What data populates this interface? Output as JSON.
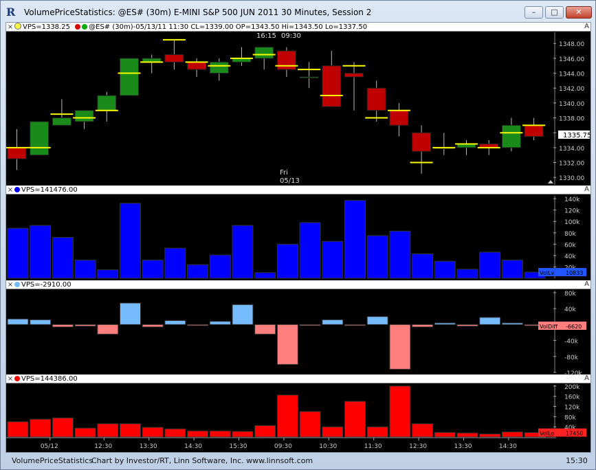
{
  "window": {
    "title": "VolumePriceStatistics: @ES# (30m) E-MINI S&P 500 JUN 2011 30 Minutes, Session 2",
    "minimize_label": "–",
    "maximize_label": "□",
    "close_label": "✕"
  },
  "panels": {
    "price": {
      "indicator_label": "VPS=1338.25",
      "info_label": "@ES# (30m)-05/13/11 11:30 CL=1339.00 OP=1343.50 Hi=1343.50 Lo=1337.50",
      "last_price": "1335.75"
    },
    "volume": {
      "indicator_label": "VPS=141476.00",
      "tag_label": "VolLv",
      "tag_value": "10833"
    },
    "voldiff": {
      "indicator_label": "VPS=-2910.00",
      "tag_label": "VolDiff",
      "tag_value": "-6620"
    },
    "volume2": {
      "indicator_label": "VPS=144386.00",
      "tag_label": "VolLo",
      "tag_value": "17450"
    }
  },
  "status_bar": {
    "left": "VolumePriceStatistics",
    "center": "Chart by Investor/RT, Linn Software, Inc. www.linnsoft.com",
    "right_time": "15:30"
  },
  "colors": {
    "up": "#1a8a1a",
    "down": "#c00000",
    "vps_line": "#ffff00",
    "volume": "#0000ff",
    "diff_pos": "#77bbff",
    "diff_neg": "#ff7f7f",
    "volume2": "#ff0000"
  },
  "chart_data": {
    "type": "candlestick",
    "categories": [
      "c1",
      "c2",
      "c3",
      "c4",
      "c5",
      "c6",
      "c7",
      "c8",
      "c9",
      "c10",
      "c11",
      "c12",
      "c13",
      "c14",
      "c15",
      "c16",
      "c17",
      "c18",
      "c19",
      "c20",
      "c21",
      "c22",
      "c23",
      "c24"
    ],
    "x_tick_labels": [
      "05/12",
      "12:30",
      "13:30",
      "14:30",
      "15:30",
      "09:30",
      "10:30",
      "11:30",
      "12:30",
      "13:30",
      "14:30"
    ],
    "price_annotations": [
      "16:15",
      "09:30",
      "Fri",
      "05/13"
    ],
    "ohlc": [
      [
        1334,
        1336.5,
        1331,
        1332.5
      ],
      [
        1333,
        1337.5,
        1333,
        1337.5
      ],
      [
        1337,
        1340.5,
        1337,
        1338
      ],
      [
        1337.5,
        1339,
        1336.5,
        1339
      ],
      [
        1339,
        1341.5,
        1337.5,
        1341
      ],
      [
        1341,
        1346,
        1341,
        1346
      ],
      [
        1345.5,
        1346.5,
        1344,
        1346
      ],
      [
        1346.5,
        1348.5,
        1344.5,
        1345.5
      ],
      [
        1345.5,
        1346,
        1343.5,
        1344.5
      ],
      [
        1344,
        1346,
        1343,
        1345.5
      ],
      [
        1345.5,
        1347.5,
        1345,
        1346
      ],
      [
        1346,
        1347.5,
        1344.5,
        1347.5
      ],
      [
        1347,
        1347.5,
        1343.5,
        1344.5
      ],
      [
        1343.5,
        1345.5,
        1342,
        1343.5
      ],
      [
        1345,
        1347,
        1339.5,
        1339.5
      ],
      [
        1344,
        1345.5,
        1339,
        1343.5
      ],
      [
        1342,
        1343,
        1337.5,
        1339
      ],
      [
        1339,
        1340,
        1335.5,
        1337
      ],
      [
        1336,
        1337,
        1330.5,
        1333.5
      ],
      [
        1334,
        1336,
        1333,
        1334
      ],
      [
        1334,
        1335,
        1333,
        1334.5
      ],
      [
        1334.5,
        1335,
        1333,
        1334
      ],
      [
        1334,
        1338,
        1333.5,
        1337
      ],
      [
        1337,
        1338,
        1335,
        1335.5
      ]
    ],
    "vps_price": [
      1334,
      1334,
      1338.5,
      1338,
      1339,
      1344,
      1345.5,
      1348.5,
      1345.5,
      1345,
      1346,
      1346.5,
      1345,
      1344.5,
      1341,
      1345,
      1338,
      1339,
      1332,
      1334,
      1334.5,
      1334,
      1336,
      1337,
      1336
    ],
    "volume_labels": [
      "140k",
      "120k",
      "100k",
      "80k",
      "60k",
      "40k",
      "20k"
    ],
    "volume": [
      88000,
      93000,
      72000,
      32000,
      15000,
      132000,
      32000,
      53000,
      24000,
      41000,
      93000,
      10000,
      60000,
      98000,
      65000,
      137000,
      75000,
      83000,
      43000,
      30000,
      16000,
      46000,
      32000,
      10833
    ],
    "voldiff_labels": [
      "80k",
      "40k",
      "0",
      "-40k",
      "-80k",
      "-120k"
    ],
    "voldiff": [
      14000,
      12000,
      -6000,
      -4000,
      -24000,
      54000,
      -6000,
      10000,
      -2000,
      8000,
      50000,
      -24000,
      -100000,
      -2000,
      12000,
      -2000,
      20000,
      -112000,
      -6000,
      4000,
      -4000,
      18000,
      4000,
      -2910
    ],
    "volume2_labels": [
      "200k",
      "160k",
      "120k",
      "80k",
      "40k"
    ],
    "volume2": [
      60000,
      70000,
      75000,
      35000,
      52000,
      52000,
      38000,
      32000,
      24000,
      24000,
      22000,
      45000,
      165000,
      100000,
      40000,
      140000,
      40000,
      200000,
      52000,
      18000,
      16000,
      12000,
      20000,
      17450
    ]
  }
}
